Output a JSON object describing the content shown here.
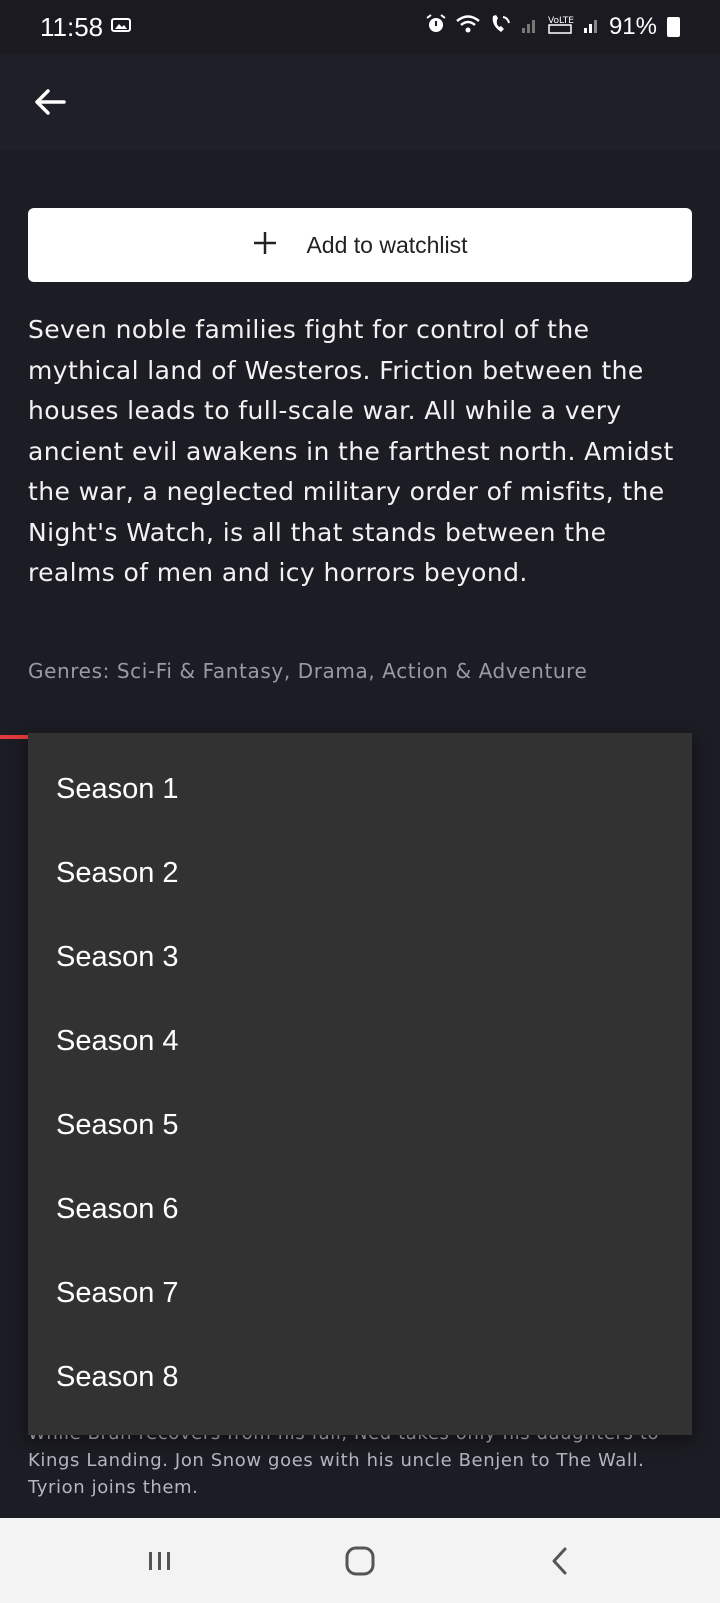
{
  "status_bar": {
    "time": "11:58",
    "battery": "91%"
  },
  "actions": {
    "watchlist_label": "Add to watchlist"
  },
  "show": {
    "overview": "Seven noble families fight for control of the mythical land of Westeros. Friction between the houses leads to full-scale war. All while a very ancient evil awakens in the farthest north. Amidst the war, a neglected military order of misfits, the Night's Watch, is all that stands between the realms of men and icy horrors beyond.",
    "genres": "Genres: Sci-Fi & Fantasy, Drama, Action & Adventure"
  },
  "season_menu": {
    "items": [
      "Season 1",
      "Season 2",
      "Season 3",
      "Season 4",
      "Season 5",
      "Season 6",
      "Season 7",
      "Season 8"
    ]
  },
  "episode_peek": {
    "text": "While Bran recovers from his fall, Ned takes only his daughters to Kings Landing. Jon Snow goes with his uncle Benjen to The Wall. Tyrion joins them."
  },
  "colors": {
    "background": "#1c1c24",
    "menu_background": "#323232",
    "accent": "#e23b3b"
  },
  "icons": [
    "alarm-icon",
    "wifi-icon",
    "wifi-call-icon",
    "signal-icon",
    "volte-icon",
    "battery-icon",
    "back-arrow-icon",
    "plus-icon",
    "recents-icon",
    "home-icon",
    "nav-back-icon"
  ]
}
